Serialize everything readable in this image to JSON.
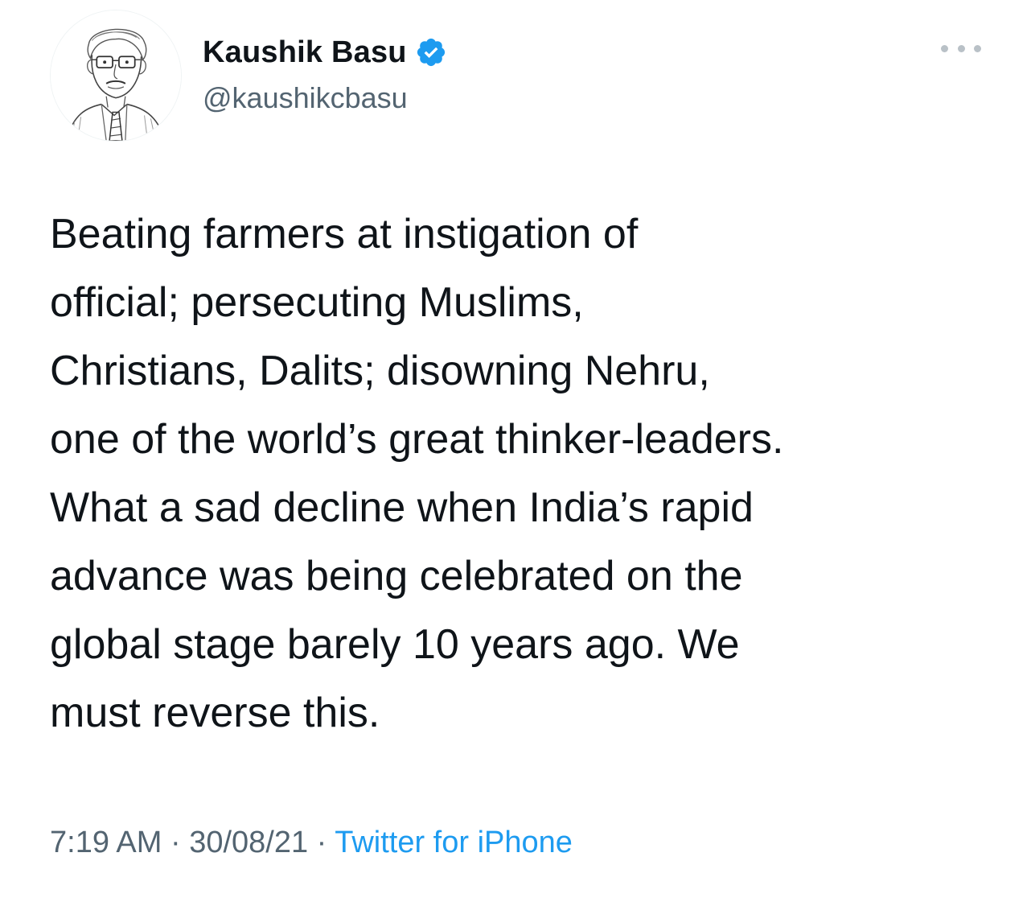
{
  "author": {
    "display_name": "Kaushik Basu",
    "handle": "@kaushikcbasu",
    "verified": true,
    "avatar_icon": "sketch-portrait-avatar"
  },
  "more_icon": "more-options-icon",
  "tweet": {
    "text": "Beating farmers at instigation of\nofficial; persecuting Muslims,\nChristians, Dalits; disowning Nehru,\none of the world’s great thinker-leaders.\nWhat a sad decline when India’s rapid\nadvance was being celebrated on the\nglobal stage barely 10 years ago. We\nmust reverse this."
  },
  "meta": {
    "time": "7:19 AM",
    "separator": " · ",
    "date": "30/08/21",
    "source": "Twitter for iPhone"
  },
  "colors": {
    "text": "#0f1419",
    "secondary": "#536471",
    "link": "#1d9bf0",
    "verified": "#1d9bf0",
    "more_dots": "#b9c1c7"
  }
}
